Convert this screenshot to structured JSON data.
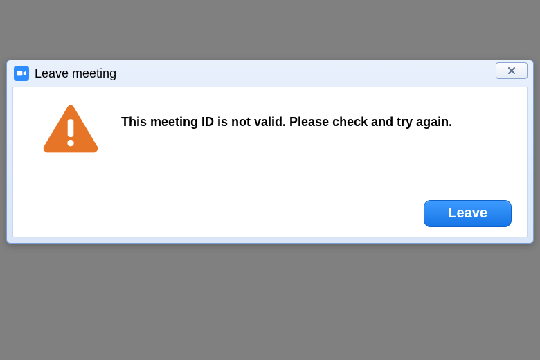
{
  "dialog": {
    "title": "Leave meeting",
    "message": "This meeting ID is not valid. Please check and try again.",
    "leave_button_label": "Leave"
  },
  "colors": {
    "accent": "#2d8cff",
    "warning": "#e67528",
    "button_primary": "#1f80f0"
  }
}
